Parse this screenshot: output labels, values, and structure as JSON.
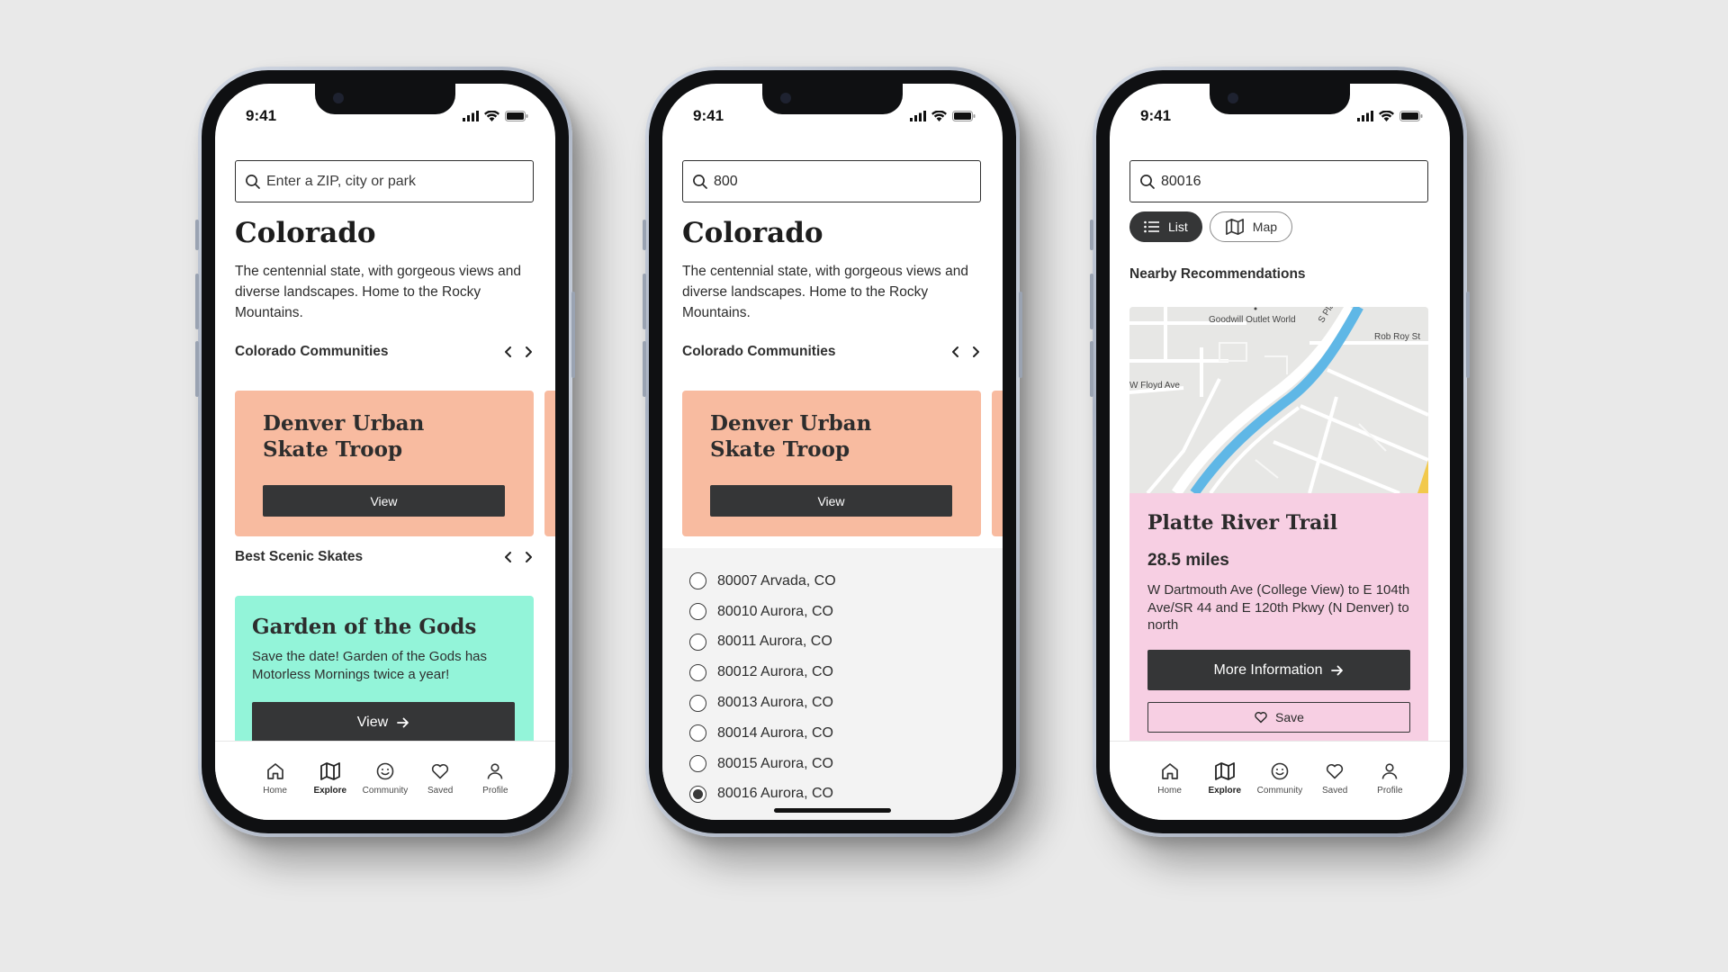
{
  "status": {
    "time": "9:41"
  },
  "nav": {
    "items": [
      {
        "label": "Home",
        "icon": "home-icon"
      },
      {
        "label": "Explore",
        "icon": "map-icon"
      },
      {
        "label": "Community",
        "icon": "smile-icon"
      },
      {
        "label": "Saved",
        "icon": "heart-icon"
      },
      {
        "label": "Profile",
        "icon": "user-icon"
      }
    ]
  },
  "screen1": {
    "search_placeholder": "Enter a ZIP, city or park",
    "title": "Colorado",
    "description": "The centennial state, with gorgeous views and diverse landscapes. Home to the Rocky Mountains.",
    "communities_heading": "Colorado Communities",
    "community_card": {
      "title": "Denver Urban Skate Troop",
      "button": "View"
    },
    "scenic_heading": "Best Scenic Skates",
    "scenic_card": {
      "title": "Garden of the Gods",
      "text": "Save the date! Garden of the Gods has Motorless Mornings twice a year!",
      "button": "View"
    },
    "active_nav": "Explore"
  },
  "screen2": {
    "search_value": "800",
    "title": "Colorado",
    "description": "The centennial state, with gorgeous views and diverse landscapes. Home to the Rocky Mountains.",
    "communities_heading": "Colorado Communities",
    "community_card": {
      "title": "Denver Urban Skate Troop",
      "button": "View"
    },
    "zip_options": [
      {
        "label": "80007 Arvada, CO",
        "selected": false
      },
      {
        "label": "80010 Aurora, CO",
        "selected": false
      },
      {
        "label": "80011 Aurora, CO",
        "selected": false
      },
      {
        "label": "80012 Aurora, CO",
        "selected": false
      },
      {
        "label": "80013 Aurora, CO",
        "selected": false
      },
      {
        "label": "80014 Aurora, CO",
        "selected": false
      },
      {
        "label": "80015 Aurora, CO",
        "selected": false
      },
      {
        "label": "80016 Aurora, CO",
        "selected": true
      }
    ]
  },
  "screen3": {
    "search_value": "80016",
    "view_toggle": {
      "list": "List",
      "map": "Map",
      "selected": "List"
    },
    "nearby_heading": "Nearby Recommendations",
    "map_labels": {
      "store": "Goodwill Outlet World",
      "street1": "Rob Roy St",
      "street2": "W Floyd Ave",
      "street3": "S Platte R"
    },
    "trail": {
      "name": "Platte River Trail",
      "distance": "28.5 miles",
      "route": "W Dartmouth Ave (College View) to E 104th Ave/SR 44 and E 120th Pkwy (N Denver) to north",
      "more_button": "More Information",
      "save_button": "Save"
    },
    "active_nav": "Explore"
  },
  "colors": {
    "background": "#e9e9e9",
    "dark_button": "#353637",
    "salmon_card": "#f8bba0",
    "mint_card": "#93f4d9",
    "pink_card": "#f7cfe3",
    "river": "#5fb7e6"
  }
}
